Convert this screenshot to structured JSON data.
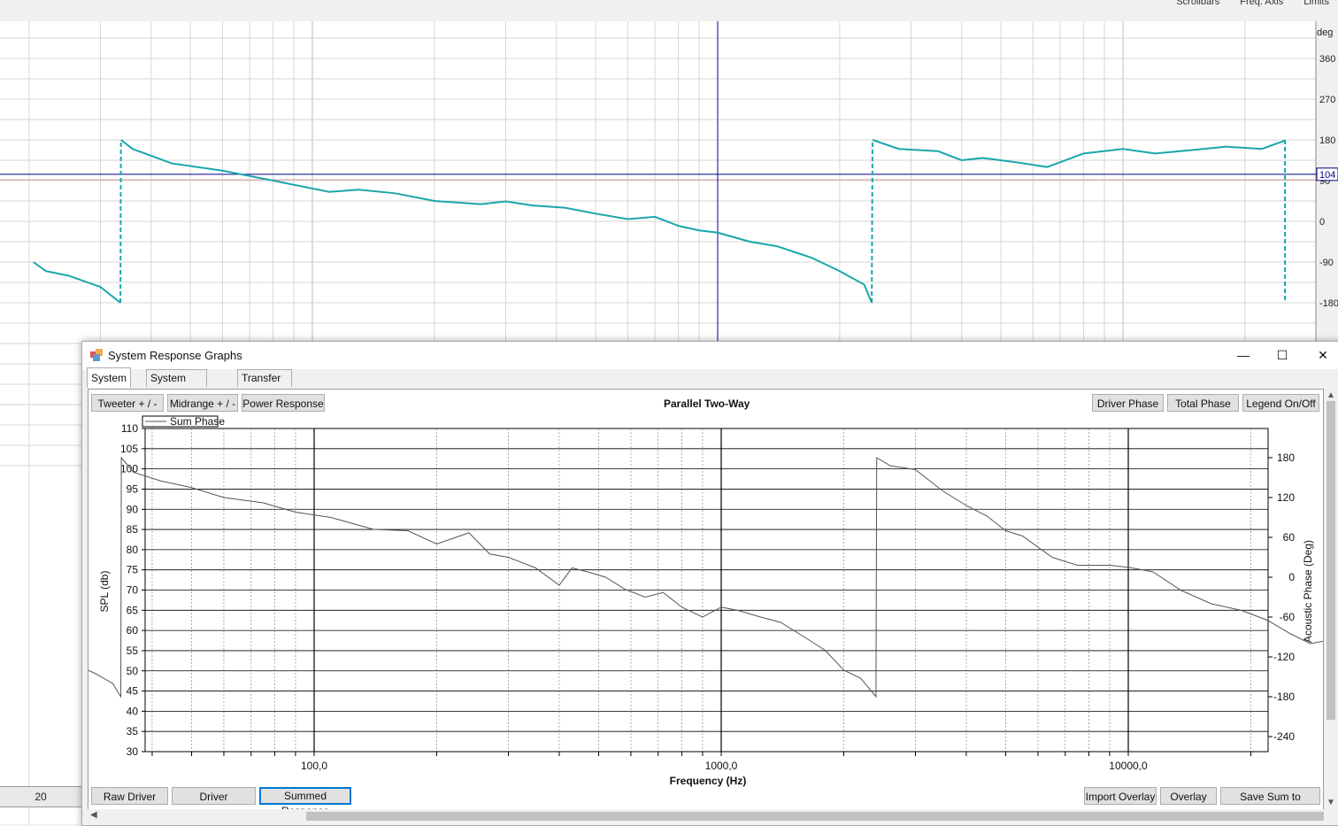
{
  "background_app": {
    "menu": [
      "Scrollbars",
      "Freq. Axis",
      "Limits"
    ],
    "unit_label": "deg",
    "phase_ticks": [
      "360",
      "270",
      "180",
      "90",
      "0",
      "-90",
      "-180"
    ],
    "cursor_value": "104",
    "freq_cell": "20",
    "trace_color": "#1aa6ac"
  },
  "window": {
    "title": "System Response Graphs",
    "minimize_label": "—",
    "maximize_label": "☐",
    "close_label": "✕",
    "icon": "app-window-icon"
  },
  "tabs": [
    {
      "label": "System SPL",
      "active": true
    },
    {
      "label": "System Impedance",
      "active": false
    },
    {
      "label": "Transfer Functions",
      "active": false
    }
  ],
  "toolbar": {
    "tweeter": "Tweeter + / -",
    "midrange": "Midrange + / -",
    "power": "Power Response",
    "driver_phase": "Driver Phase",
    "total_phase": "Total Phase",
    "legend": "Legend On/Off"
  },
  "bottom_buttons": {
    "raw": "Raw Driver SPL",
    "driver_responses": "Driver Responses",
    "summed": "Summed Response",
    "import_overlay": "Import Overlay",
    "overlay": "Overlay",
    "save_sum": "Save Sum to Overlay"
  },
  "chart_data": {
    "type": "line",
    "title": "Parallel Two-Way",
    "xlabel": "Frequency (Hz)",
    "ylabel": "SPL (db)",
    "y2label": "Acoustic Phase (Deg)",
    "x_scale": "log",
    "xlim": [
      20,
      35000
    ],
    "ylim": [
      30,
      110
    ],
    "y2lim": [
      -270,
      200
    ],
    "x_tick_labels": [
      "100,0",
      "1000,0",
      "10000,0"
    ],
    "y_ticks": [
      30,
      35,
      40,
      45,
      50,
      55,
      60,
      65,
      70,
      75,
      80,
      85,
      90,
      95,
      100,
      105,
      110
    ],
    "y2_ticks": [
      180,
      120,
      60,
      0,
      -60,
      -120,
      -180,
      -240
    ],
    "legend": [
      "Sum Phase"
    ],
    "legend_position": "top-left",
    "grid": true,
    "series": [
      {
        "name": "Sum Phase",
        "axis": "right",
        "color": "#555555",
        "points": [
          [
            21,
            -120
          ],
          [
            23,
            -124
          ],
          [
            26,
            -132
          ],
          [
            29,
            -145
          ],
          [
            32,
            -160
          ],
          [
            33.5,
            -180
          ],
          [
            33.6,
            180
          ],
          [
            36,
            158
          ],
          [
            42,
            145
          ],
          [
            50,
            135
          ],
          [
            60,
            120
          ],
          [
            75,
            112
          ],
          [
            90,
            98
          ],
          [
            110,
            90
          ],
          [
            140,
            72
          ],
          [
            170,
            70
          ],
          [
            200,
            50
          ],
          [
            240,
            67
          ],
          [
            270,
            35
          ],
          [
            300,
            30
          ],
          [
            350,
            14
          ],
          [
            400,
            -12
          ],
          [
            430,
            14
          ],
          [
            470,
            8
          ],
          [
            520,
            0
          ],
          [
            580,
            -18
          ],
          [
            650,
            -30
          ],
          [
            720,
            -23
          ],
          [
            800,
            -45
          ],
          [
            900,
            -60
          ],
          [
            1000,
            -45
          ],
          [
            1100,
            -50
          ],
          [
            1250,
            -60
          ],
          [
            1400,
            -68
          ],
          [
            1600,
            -90
          ],
          [
            1800,
            -110
          ],
          [
            2000,
            -140
          ],
          [
            2200,
            -152
          ],
          [
            2400,
            -180
          ],
          [
            2410,
            180
          ],
          [
            2600,
            168
          ],
          [
            3000,
            162
          ],
          [
            3500,
            130
          ],
          [
            4000,
            108
          ],
          [
            4500,
            92
          ],
          [
            5000,
            70
          ],
          [
            5500,
            62
          ],
          [
            6500,
            30
          ],
          [
            7500,
            18
          ],
          [
            9000,
            18
          ],
          [
            10000,
            15
          ],
          [
            11500,
            8
          ],
          [
            13500,
            -20
          ],
          [
            16000,
            -40
          ],
          [
            19000,
            -50
          ],
          [
            22000,
            -65
          ],
          [
            25000,
            -85
          ],
          [
            28000,
            -100
          ],
          [
            31000,
            -95
          ]
        ]
      }
    ]
  },
  "background_chart_data": {
    "type": "line",
    "ylabel": "deg",
    "x_scale": "log",
    "series": [
      {
        "name": "phase",
        "points": [
          [
            20.5,
            -90
          ],
          [
            22,
            -110
          ],
          [
            25,
            -120
          ],
          [
            30,
            -145
          ],
          [
            33.6,
            -180
          ],
          [
            33.7,
            180
          ],
          [
            36,
            160
          ],
          [
            45,
            128
          ],
          [
            60,
            112
          ],
          [
            80,
            90
          ],
          [
            110,
            65
          ],
          [
            130,
            70
          ],
          [
            160,
            62
          ],
          [
            200,
            45
          ],
          [
            260,
            38
          ],
          [
            300,
            44
          ],
          [
            350,
            35
          ],
          [
            420,
            30
          ],
          [
            500,
            17
          ],
          [
            600,
            5
          ],
          [
            700,
            10
          ],
          [
            800,
            -10
          ],
          [
            900,
            -20
          ],
          [
            1000,
            -25
          ],
          [
            1200,
            -45
          ],
          [
            1400,
            -55
          ],
          [
            1700,
            -80
          ],
          [
            2000,
            -110
          ],
          [
            2300,
            -140
          ],
          [
            2400,
            -180
          ],
          [
            2410,
            180
          ],
          [
            2800,
            160
          ],
          [
            3500,
            155
          ],
          [
            4000,
            135
          ],
          [
            4500,
            140
          ],
          [
            5500,
            130
          ],
          [
            6500,
            120
          ],
          [
            8000,
            150
          ],
          [
            10000,
            160
          ],
          [
            12000,
            150
          ],
          [
            15000,
            158
          ],
          [
            18000,
            165
          ],
          [
            22000,
            160
          ],
          [
            25000,
            178
          ],
          [
            25100,
            180
          ]
        ]
      }
    ]
  }
}
